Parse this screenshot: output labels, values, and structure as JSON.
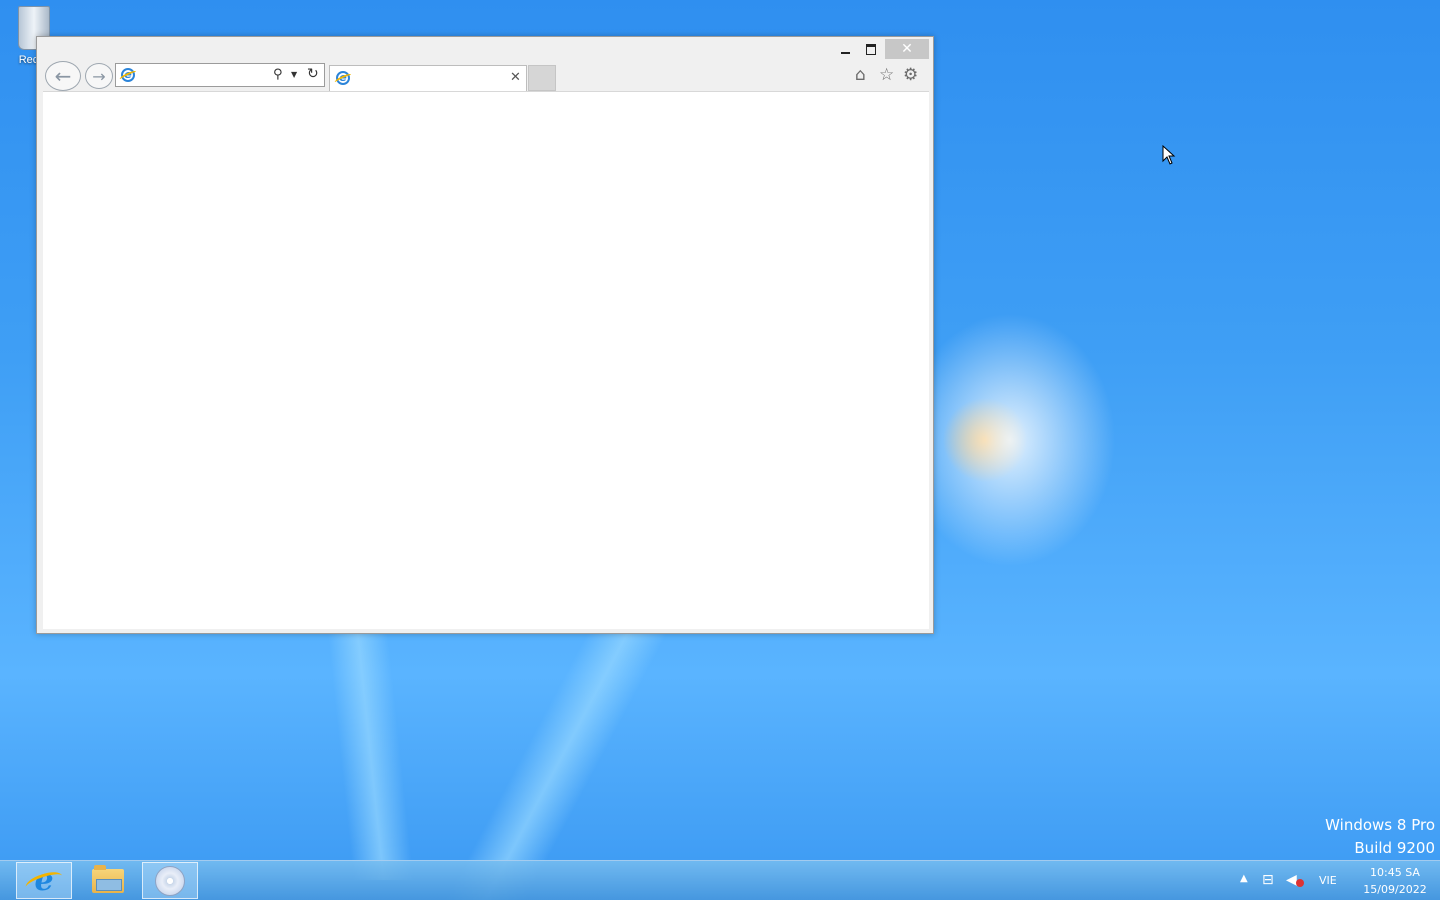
{
  "desktop": {
    "recycle_bin_label": "Recyc",
    "watermark_line1": "Windows 8 Pro",
    "watermark_line2": "Build 9200"
  },
  "browser": {
    "address": {
      "value": "",
      "placeholder": ""
    },
    "tab": {
      "title": ""
    },
    "window_controls": {
      "minimize": "minimize",
      "maximize": "maximize",
      "close": "close"
    },
    "toolbar_icons": [
      "home-icon",
      "favorites-icon",
      "tools-icon"
    ]
  },
  "taskbar": {
    "pinned": [
      "internet-explorer-icon",
      "file-explorer-icon",
      "disc-burn-icon"
    ],
    "tray": {
      "language": "VIE",
      "time": "10:45 SA",
      "date": "15/09/2022"
    }
  },
  "colors": {
    "desktop_blue": "#3f9ff5",
    "close_button": "#c7c7c7",
    "ie_blue": "#2b84d9"
  }
}
